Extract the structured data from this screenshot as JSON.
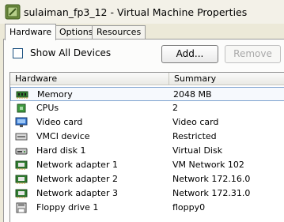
{
  "window": {
    "title": "sulaiman_fp3_12 - Virtual Machine Properties",
    "icon": "vm-properties-icon"
  },
  "tabs": [
    {
      "label": "Hardware",
      "active": true
    },
    {
      "label": "Options",
      "active": false
    },
    {
      "label": "Resources",
      "active": false
    }
  ],
  "hardware_tab": {
    "show_all_devices_label": "Show All Devices",
    "show_all_devices_checked": false,
    "add_button": "Add...",
    "remove_button": "Remove",
    "remove_enabled": false,
    "columns": [
      "Hardware",
      "Summary"
    ],
    "devices": [
      {
        "name": "Memory",
        "summary": "2048 MB",
        "icon": "memory-icon",
        "selected": true
      },
      {
        "name": "CPUs",
        "summary": "2",
        "icon": "cpu-icon",
        "selected": false
      },
      {
        "name": "Video card",
        "summary": "Video card",
        "icon": "monitor-icon",
        "selected": false
      },
      {
        "name": "VMCI device",
        "summary": "Restricted",
        "icon": "vmci-device-icon",
        "selected": false
      },
      {
        "name": "Hard disk 1",
        "summary": "Virtual Disk",
        "icon": "hard-disk-icon",
        "selected": false
      },
      {
        "name": "Network adapter 1",
        "summary": "VM Network 102",
        "icon": "network-adapter-icon",
        "selected": false
      },
      {
        "name": "Network adapter 2",
        "summary": "Network 172.16.0",
        "icon": "network-adapter-icon",
        "selected": false
      },
      {
        "name": "Network adapter 3",
        "summary": "Network 172.31.0",
        "icon": "network-adapter-icon",
        "selected": false
      },
      {
        "name": "Floppy drive 1",
        "summary": "floppy0",
        "icon": "floppy-drive-icon",
        "selected": false
      }
    ]
  },
  "colors": {
    "selection_border": "#7da2ce",
    "selection_fill": "#f6f9fd",
    "window_background": "#ece9d8"
  }
}
